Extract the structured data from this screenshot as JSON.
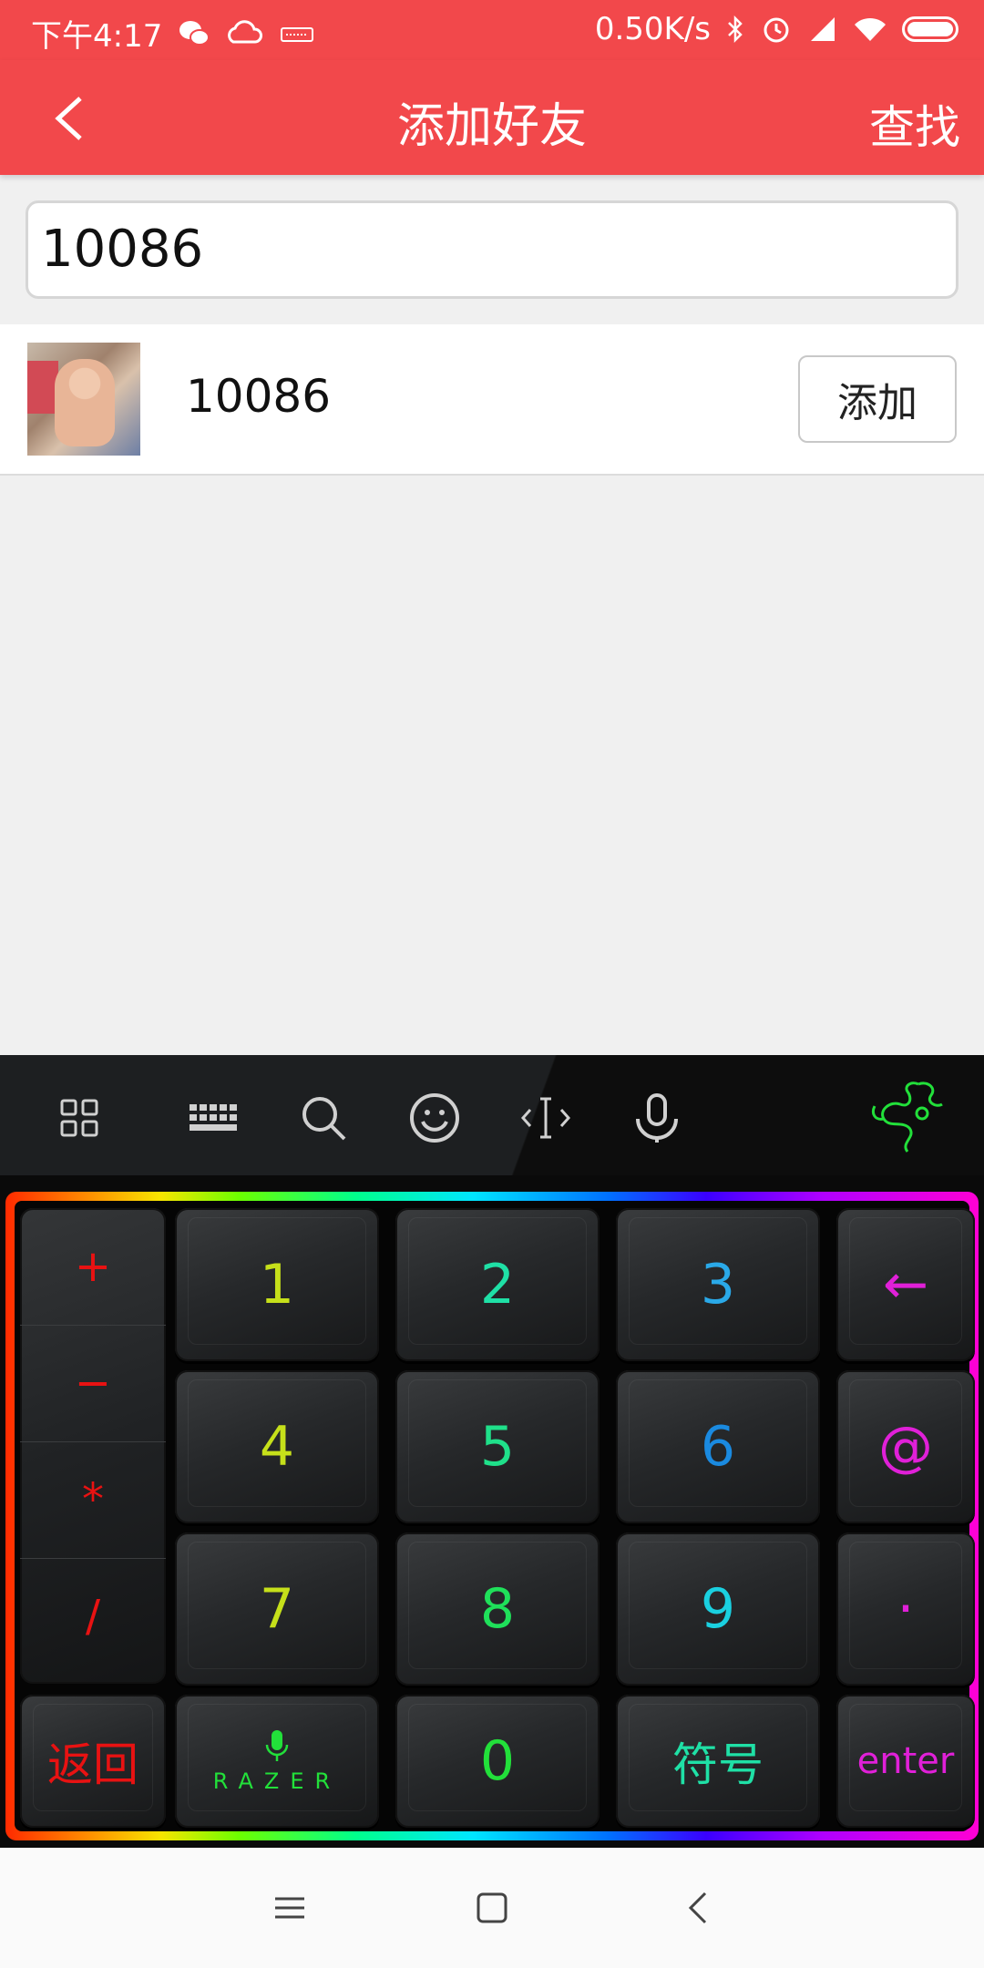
{
  "status_bar": {
    "time": "下午4:17",
    "speed": "0.50K/s",
    "icons_left": [
      "wechat-icon",
      "cloud-icon",
      "keyboard-icon"
    ],
    "icons_right": [
      "bluetooth-icon",
      "alarm-icon",
      "signal-icon",
      "wifi-icon",
      "battery-icon"
    ]
  },
  "toolbar": {
    "title": "添加好友",
    "find_label": "查找",
    "back_icon": "chevron-left-icon"
  },
  "search": {
    "value": "10086"
  },
  "result": {
    "name": "10086",
    "add_label": "添加"
  },
  "keyboard": {
    "toolbar_icons": [
      "grid-icon",
      "keyboard-icon",
      "search-icon",
      "emoji-icon",
      "cursor-icon",
      "microphone-icon",
      "razer-logo-icon"
    ],
    "operators": [
      "+",
      "−",
      "*",
      "/"
    ],
    "digits_row1": [
      "1",
      "2",
      "3"
    ],
    "digits_row2": [
      "4",
      "5",
      "6"
    ],
    "digits_row3": [
      "7",
      "8",
      "9"
    ],
    "backspace_label": "←",
    "at_label": "@",
    "dot_label": "·",
    "return_label": "返回",
    "razer_label": "RAZER",
    "zero_label": "0",
    "symbol_label": "符号",
    "enter_label": "enter"
  },
  "colors": {
    "brand_red": "#f2484b",
    "operator_red": "#e81212",
    "razer_green": "#22e03a"
  },
  "nav": {
    "icons": [
      "menu-icon",
      "home-icon",
      "back-icon"
    ]
  }
}
